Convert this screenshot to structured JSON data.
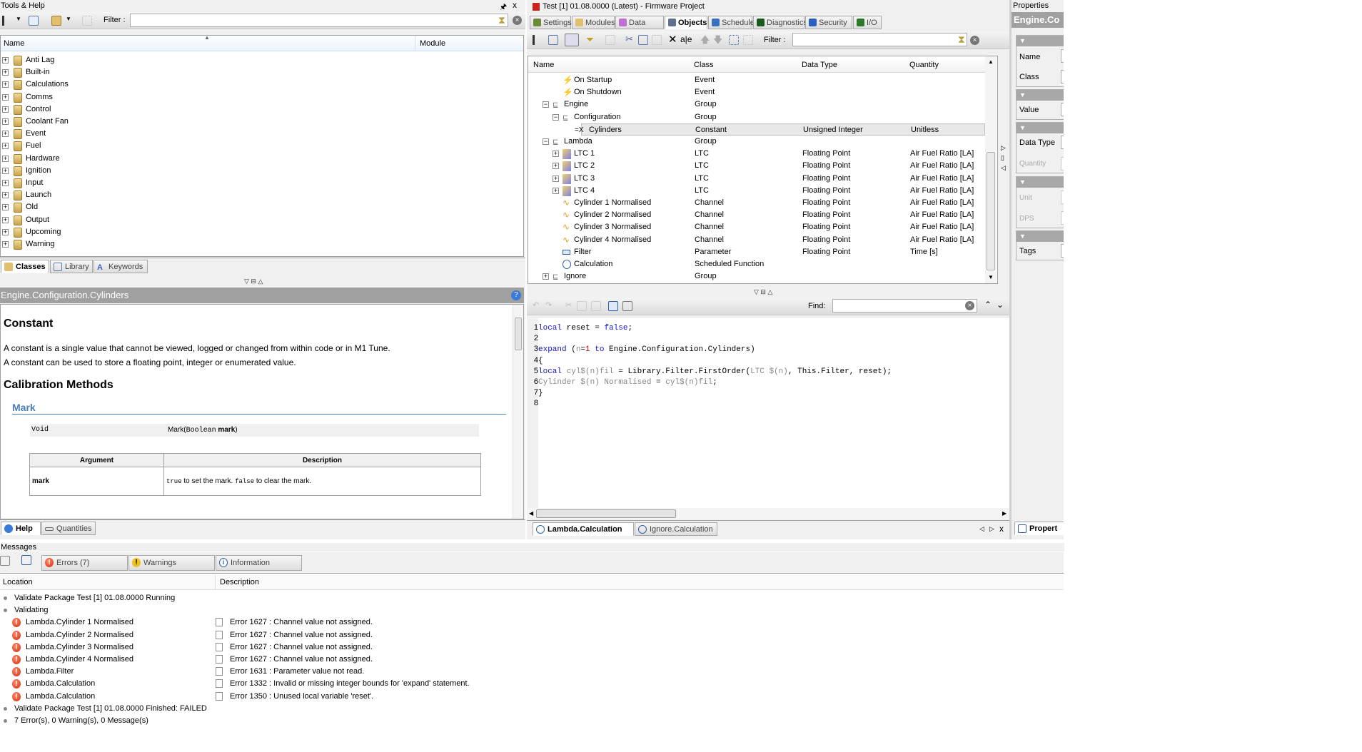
{
  "tools_help": {
    "title": "Tools & Help",
    "filter_label": "Filter :",
    "filter_value": "",
    "columns": [
      "Name",
      "Module"
    ],
    "items": [
      "Anti Lag",
      "Built-in",
      "Calculations",
      "Comms",
      "Control",
      "Coolant Fan",
      "Event",
      "Fuel",
      "Hardware",
      "Ignition",
      "Input",
      "Launch",
      "Old",
      "Output",
      "Upcoming",
      "Warning"
    ],
    "tabs": [
      "Classes",
      "Library",
      "Keywords"
    ],
    "active_tab": "Classes"
  },
  "help": {
    "title": "Engine.Configuration.Cylinders",
    "heading": "Constant",
    "para1": "A constant is a single value that cannot be viewed, logged or changed from within code or in M1 Tune.",
    "para2": "A constant can be used to store a floating point, integer or enumerated value.",
    "section": "Calibration Methods",
    "method_name": "Mark",
    "sig_return": "Void",
    "sig_name": "Mark(",
    "sig_type": "Boolean",
    "sig_arg": " mark",
    "sig_close": ")",
    "arg_headers": [
      "Argument",
      "Description"
    ],
    "arg_name": "mark",
    "arg_desc_true": "true",
    "arg_desc_mid": " to set the mark. ",
    "arg_desc_false": "false",
    "arg_desc_end": " to clear the mark.",
    "tabs": [
      "Help",
      "Quantities"
    ],
    "active_tab": "Help"
  },
  "project": {
    "title": "Test [1] 01.08.0000 (Latest) - Firmware Project",
    "tabs": [
      "Settings",
      "Modules",
      "Data Types",
      "Objects",
      "Schedule",
      "Diagnostics",
      "Security",
      "I/O"
    ],
    "active_tab": "Objects",
    "filter_label": "Filter :",
    "filter_value": "",
    "columns": [
      "Name",
      "Class",
      "Data Type",
      "Quantity"
    ],
    "rows": [
      {
        "name": "On Startup",
        "class": "Event",
        "type": "",
        "quantity": "",
        "icon": "event-icon",
        "level": 2
      },
      {
        "name": "On Shutdown",
        "class": "Event",
        "type": "",
        "quantity": "",
        "icon": "event-icon",
        "level": 2
      },
      {
        "name": "Engine",
        "class": "Group",
        "type": "",
        "quantity": "",
        "icon": "group-icon",
        "level": 1,
        "expander": "−"
      },
      {
        "name": "Configuration",
        "class": "Group",
        "type": "",
        "quantity": "",
        "icon": "group-icon",
        "level": 2,
        "expander": "−"
      },
      {
        "name": "Cylinders",
        "class": "Constant",
        "type": "Unsigned Integer",
        "quantity": "Unitless",
        "icon": "constant-icon",
        "level": 3,
        "selected": true
      },
      {
        "name": "Lambda",
        "class": "Group",
        "type": "",
        "quantity": "",
        "icon": "group-icon",
        "level": 1,
        "expander": "−"
      },
      {
        "name": "LTC 1",
        "class": "LTC",
        "type": "Floating Point",
        "quantity": "Air Fuel Ratio [LA]",
        "icon": "ltc-icon",
        "level": 2,
        "expander": "+"
      },
      {
        "name": "LTC 2",
        "class": "LTC",
        "type": "Floating Point",
        "quantity": "Air Fuel Ratio [LA]",
        "icon": "ltc-icon",
        "level": 2,
        "expander": "+"
      },
      {
        "name": "LTC 3",
        "class": "LTC",
        "type": "Floating Point",
        "quantity": "Air Fuel Ratio [LA]",
        "icon": "ltc-icon",
        "level": 2,
        "expander": "+"
      },
      {
        "name": "LTC 4",
        "class": "LTC",
        "type": "Floating Point",
        "quantity": "Air Fuel Ratio [LA]",
        "icon": "ltc-icon",
        "level": 2,
        "expander": "+"
      },
      {
        "name": "Cylinder 1 Normalised",
        "class": "Channel",
        "type": "Floating Point",
        "quantity": "Air Fuel Ratio [LA]",
        "icon": "channel-icon",
        "level": 2
      },
      {
        "name": "Cylinder 2 Normalised",
        "class": "Channel",
        "type": "Floating Point",
        "quantity": "Air Fuel Ratio [LA]",
        "icon": "channel-icon",
        "level": 2
      },
      {
        "name": "Cylinder 3 Normalised",
        "class": "Channel",
        "type": "Floating Point",
        "quantity": "Air Fuel Ratio [LA]",
        "icon": "channel-icon",
        "level": 2
      },
      {
        "name": "Cylinder 4 Normalised",
        "class": "Channel",
        "type": "Floating Point",
        "quantity": "Air Fuel Ratio [LA]",
        "icon": "channel-icon",
        "level": 2
      },
      {
        "name": "Filter",
        "class": "Parameter",
        "type": "Floating Point",
        "quantity": "Time [s]",
        "icon": "parameter-icon",
        "level": 2
      },
      {
        "name": "Calculation",
        "class": "Scheduled Function",
        "type": "",
        "quantity": "",
        "icon": "scheduled-function-icon",
        "level": 2
      },
      {
        "name": "Ignore",
        "class": "Group",
        "type": "",
        "quantity": "",
        "icon": "group-icon",
        "level": 1,
        "expander": "+"
      }
    ]
  },
  "editor": {
    "find_label": "Find:",
    "find_value": "",
    "lines": [
      [
        {
          "t": "local",
          "c": "kw"
        },
        {
          "t": " reset = "
        },
        {
          "t": "false",
          "c": "kw"
        },
        {
          "t": ";"
        }
      ],
      [],
      [
        {
          "t": "expand",
          "c": "kw"
        },
        {
          "t": " ("
        },
        {
          "t": "n",
          "c": "gr"
        },
        {
          "t": "="
        },
        {
          "t": "1",
          "c": "num"
        },
        {
          "t": " "
        },
        {
          "t": "to",
          "c": "kw"
        },
        {
          "t": " Engine.Configuration.Cylinders)"
        }
      ],
      [
        {
          "t": "{"
        }
      ],
      [
        {
          "t": "local",
          "c": "kw"
        },
        {
          "t": " cyl$(n)fil",
          "c": "gr"
        },
        {
          "t": " = Library.Filter.FirstOrder("
        },
        {
          "t": "LTC $(n)",
          "c": "gr"
        },
        {
          "t": ", This.Filter, reset);"
        }
      ],
      [
        {
          "t": "Cylinder $(n) Normalised",
          "c": "gr"
        },
        {
          "t": " = "
        },
        {
          "t": "cyl$(n)fil",
          "c": "gr"
        },
        {
          "t": ";"
        }
      ],
      [
        {
          "t": "}"
        }
      ],
      []
    ],
    "doc_tabs": [
      "Lambda.Calculation",
      "Ignore.Calculation"
    ],
    "active_doc": "Lambda.Calculation"
  },
  "properties": {
    "title": "Properties",
    "header": "Engine.Co",
    "fields": [
      "Name",
      "Class",
      "Value",
      "Data Type",
      "Quantity",
      "Unit",
      "DPS",
      "Tags"
    ],
    "tab": "Propert"
  },
  "messages": {
    "title": "Messages",
    "filters": [
      "Errors (7)",
      "Warnings",
      "Information"
    ],
    "columns": [
      "Location",
      "Description"
    ],
    "rows": [
      {
        "kind": "info",
        "location": "Validate Package Test [1] 01.08.0000 Running",
        "description": ""
      },
      {
        "kind": "info",
        "location": "Validating",
        "description": ""
      },
      {
        "kind": "error",
        "location": "Lambda.Cylinder 1 Normalised",
        "description": "Error 1627 : Channel value not assigned."
      },
      {
        "kind": "error",
        "location": "Lambda.Cylinder 2 Normalised",
        "description": "Error 1627 : Channel value not assigned."
      },
      {
        "kind": "error",
        "location": "Lambda.Cylinder 3 Normalised",
        "description": "Error 1627 : Channel value not assigned."
      },
      {
        "kind": "error",
        "location": "Lambda.Cylinder 4 Normalised",
        "description": "Error 1627 : Channel value not assigned."
      },
      {
        "kind": "error",
        "location": "Lambda.Filter",
        "description": "Error 1631 : Parameter value not read."
      },
      {
        "kind": "error",
        "location": "Lambda.Calculation",
        "description": "Error 1332 : Invalid or missing integer bounds for 'expand' statement."
      },
      {
        "kind": "error",
        "location": "Lambda.Calculation",
        "description": "Error 1350 : Unused local variable 'reset'."
      },
      {
        "kind": "info",
        "location": "Validate Package Test [1] 01.08.0000 Finished: FAILED",
        "description": ""
      },
      {
        "kind": "info",
        "location": "7 Error(s), 0 Warning(s), 0 Message(s)",
        "description": ""
      }
    ]
  },
  "colors": {
    "keyword": "#1515c8",
    "error": "#d42a0a",
    "selection": "#e8e8e8",
    "help_title_bar": "#a0a0a0",
    "method_link": "#4a7fb5"
  }
}
